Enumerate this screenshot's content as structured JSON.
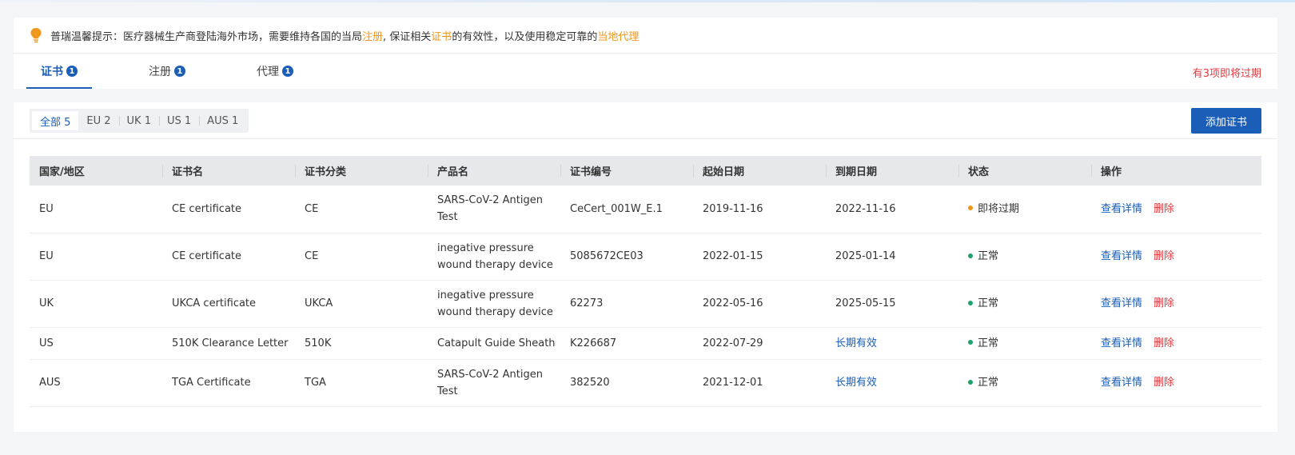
{
  "tip": {
    "prefix": "普瑞温馨提示：医疗器械生产商登陆海外市场，需要维持各国的当局",
    "hl1": "注册",
    "mid1": ", 保证相关",
    "hl2": "证书",
    "mid2": "的有效性，以及使用稳定可靠的",
    "hl3": "当地代理"
  },
  "tabs": [
    {
      "label": "证书",
      "badge": "1"
    },
    {
      "label": "注册",
      "badge": "1"
    },
    {
      "label": "代理",
      "badge": "1"
    }
  ],
  "expiring_note": "有3项即将过期",
  "filters": [
    "全部 5",
    "EU 2",
    "UK 1",
    "US 1",
    "AUS 1"
  ],
  "add_button": "添加证书",
  "columns": [
    "国家/地区",
    "证书名",
    "证书分类",
    "产品名",
    "证书编号",
    "起始日期",
    "到期日期",
    "状态",
    "操作"
  ],
  "rows": [
    {
      "region": "EU",
      "name": "CE certificate",
      "category": "CE",
      "product": "SARS-CoV-2 Antigen Test",
      "number": "CeCert_001W_E.1",
      "start": "2019-11-16",
      "end": "2022-11-16",
      "end_link": false,
      "status": "即将过期",
      "status_color": "#f0961a"
    },
    {
      "region": "EU",
      "name": "CE certificate",
      "category": "CE",
      "product": "inegative pressure wound therapy device",
      "number": "5085672CE03",
      "start": "2022-01-15",
      "end": "2025-01-14",
      "end_link": false,
      "status": "正常",
      "status_color": "#1aa36b"
    },
    {
      "region": "UK",
      "name": "UKCA certificate",
      "category": "UKCA",
      "product": "inegative pressure wound therapy device",
      "number": "62273",
      "start": "2022-05-16",
      "end": "2025-05-15",
      "end_link": false,
      "status": "正常",
      "status_color": "#1aa36b"
    },
    {
      "region": "US",
      "name": "510K Clearance Letter",
      "category": "510K",
      "product": "Catapult Guide Sheath",
      "number": "K226687",
      "start": "2022-07-29",
      "end": "长期有效",
      "end_link": true,
      "status": "正常",
      "status_color": "#1aa36b"
    },
    {
      "region": "AUS",
      "name": "TGA Certificate",
      "category": "TGA",
      "product": "SARS-CoV-2 Antigen Test",
      "number": "382520",
      "start": "2021-12-01",
      "end": "长期有效",
      "end_link": true,
      "status": "正常",
      "status_color": "#1aa36b"
    }
  ],
  "actions": {
    "view": "查看详情",
    "delete": "删除"
  },
  "colors": {
    "primary": "#1a5eb8",
    "highlight": "#f0961a",
    "danger": "#e0393e",
    "ok": "#1aa36b"
  }
}
